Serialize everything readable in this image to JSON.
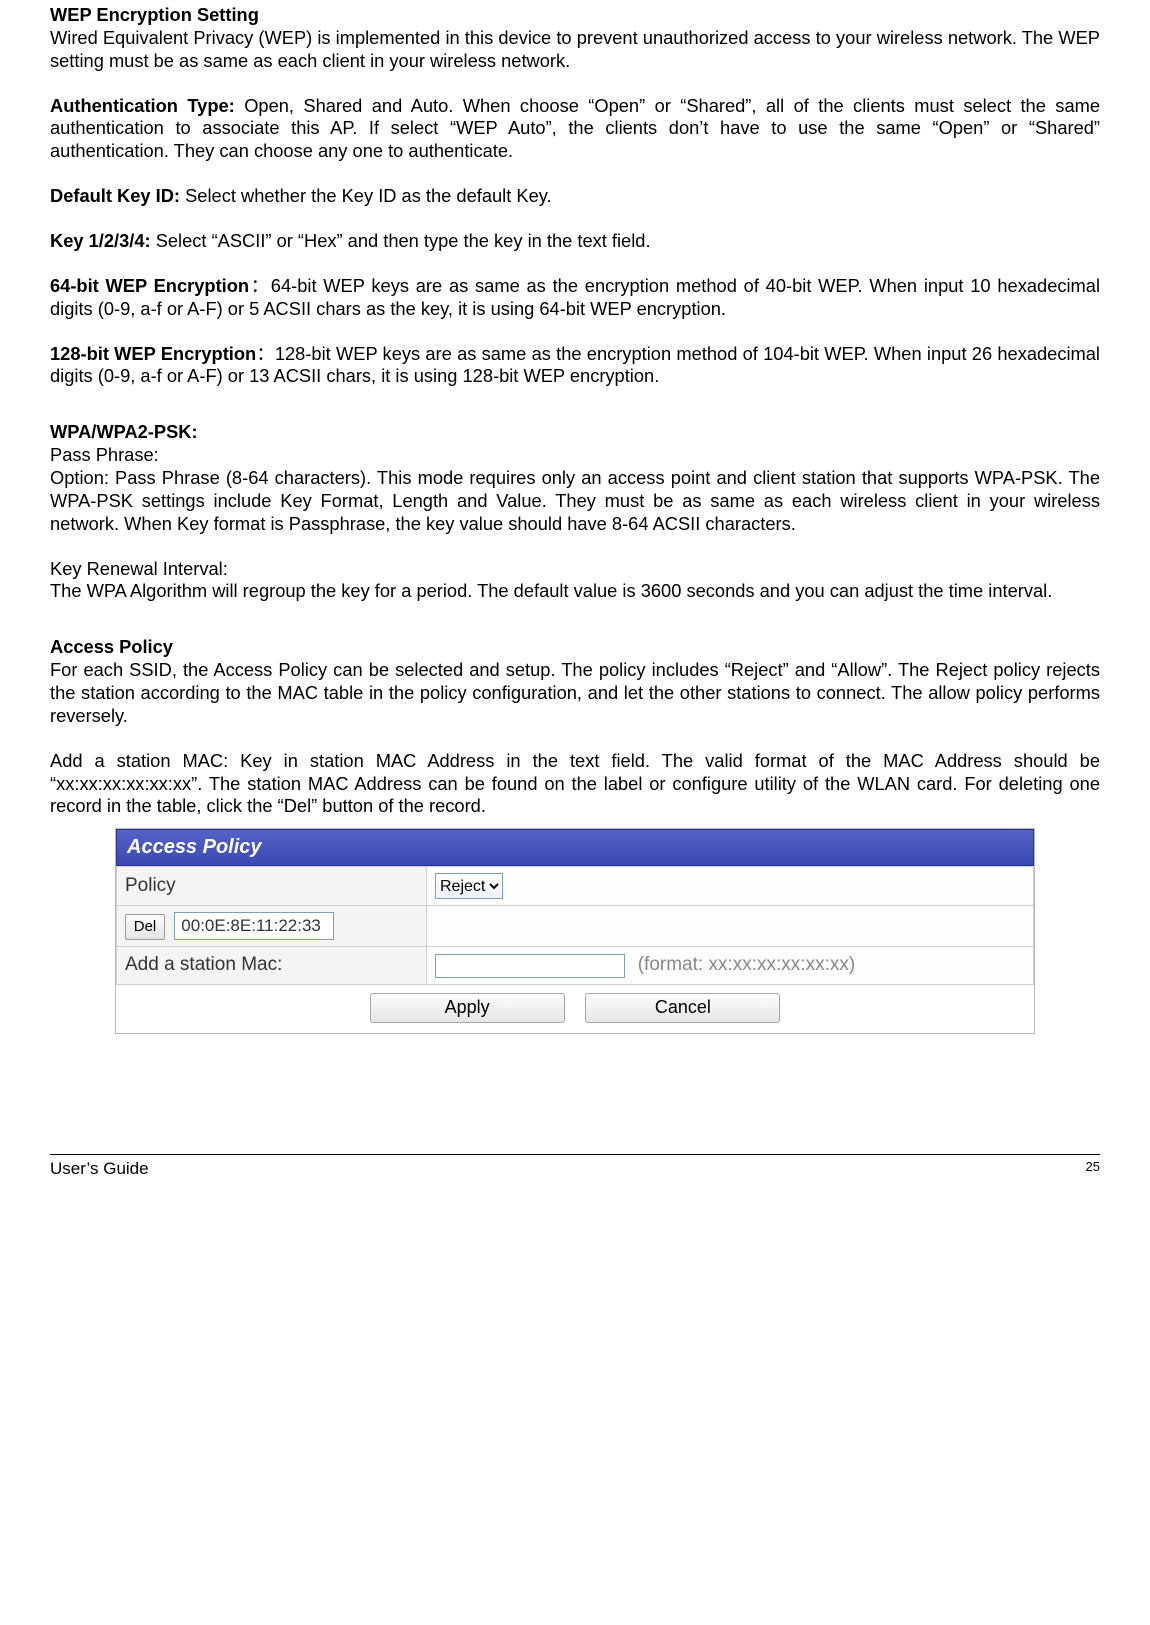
{
  "sections": {
    "wep": {
      "title": "WEP Encryption Setting",
      "intro": "Wired Equivalent Privacy (WEP) is implemented in this device to prevent unauthorized access to your wireless network. The WEP setting must be as same as each client in your wireless network.",
      "auth_label": "Authentication Type:",
      "auth_text": " Open, Shared and Auto. When choose “Open” or “Shared”, all of the clients must select the same authentication to associate this AP. If select “WEP Auto”, the clients don’t have to use the same “Open” or “Shared” authentication. They can choose any one to authenticate.",
      "default_key_label": "Default Key ID:",
      "default_key_text": " Select whether the Key ID as the default Key.",
      "key_1234_label": "Key 1/2/3/4:",
      "key_1234_text": " Select “ASCII” or “Hex” and then type the key in the text field.",
      "b64_label": "64-bit WEP Encryption",
      "b64_colon": "：",
      "b64_text": "64-bit WEP keys are as same as the encryption method of 40-bit WEP. When input 10 hexadecimal digits (0-9, a-f or A-F) or 5 ACSII chars as the key, it is using 64-bit WEP encryption.",
      "b128_label": "128-bit WEP Encryption",
      "b128_colon": "：",
      "b128_text": "128-bit WEP keys are as same as the encryption method of 104-bit WEP. When input 26 hexadecimal digits (0-9, a-f or A-F) or 13 ACSII chars, it is using 128-bit WEP encryption."
    },
    "wpa": {
      "title": "WPA/WPA2-PSK:",
      "pp_label": "Pass Phrase:",
      "pp_text": "Option: Pass Phrase (8-64 characters). This mode requires only an access point and client station that supports WPA-PSK. The WPA-PSK settings include Key Format, Length and Value. They must be as same as each wireless client in your wireless network. When Key format is Passphrase, the key value should have 8-64 ACSII characters.",
      "kri_label": "Key Renewal Interval:",
      "kri_text": "The WPA Algorithm will regroup the key for a period. The default value is 3600 seconds and you can adjust the time interval."
    },
    "ap": {
      "title": "Access Policy",
      "p1": "For each SSID, the Access Policy can be selected and setup. The policy includes “Reject” and “Allow”. The Reject policy rejects the station according to the MAC table in the policy configuration, and let the other stations to connect. The allow policy performs reversely.",
      "p2": "Add a station MAC: Key in station MAC Address in the text field. The valid format of the MAC Address should be “xx:xx:xx:xx:xx:xx”. The station MAC Address can be found on the label or configure utility of the WLAN card. For deleting one record in the table, click the “Del” button of the record."
    }
  },
  "panel": {
    "header": "Access Policy",
    "policy_label": "Policy",
    "policy_value": "Reject",
    "del_label": "Del",
    "mac_entry": "00:0E:8E:11:22:33",
    "add_label": "Add a station Mac:",
    "add_value": "",
    "format_hint": "(format: xx:xx:xx:xx:xx:xx)",
    "apply_label": "Apply",
    "cancel_label": "Cancel"
  },
  "footer": {
    "left": "User’s Guide",
    "right": "25"
  }
}
